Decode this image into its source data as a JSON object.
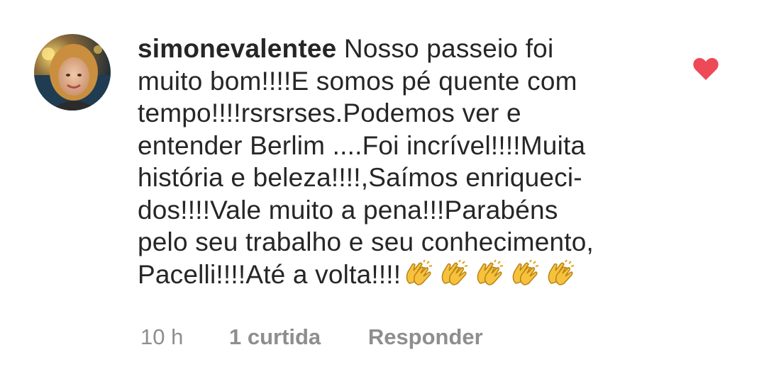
{
  "comment": {
    "username": "simonevalentee",
    "text_lines": [
      "Nosso passeio foi",
      "muito bom!!!!E somos pé quente com",
      "tempo!!!!rsrsrses.Podemos ver e",
      "entender Berlim ....Foi incrível!!!!Muita",
      "história e beleza!!!!,Saímos enriqueci-",
      "dos!!!!Vale muito a pena!!!Parabéns",
      "pelo seu trabalho e seu conhecimento,",
      "Pacelli!!!!Até a volta!!!!"
    ],
    "emoji": [
      "clapping-hands",
      "clapping-hands",
      "clapping-hands",
      "clapping-hands",
      "clapping-hands"
    ],
    "liked": true,
    "heart_color": "#ed4956",
    "meta": {
      "time": "10 h",
      "likes": "1 curtida",
      "reply": "Responder"
    }
  }
}
